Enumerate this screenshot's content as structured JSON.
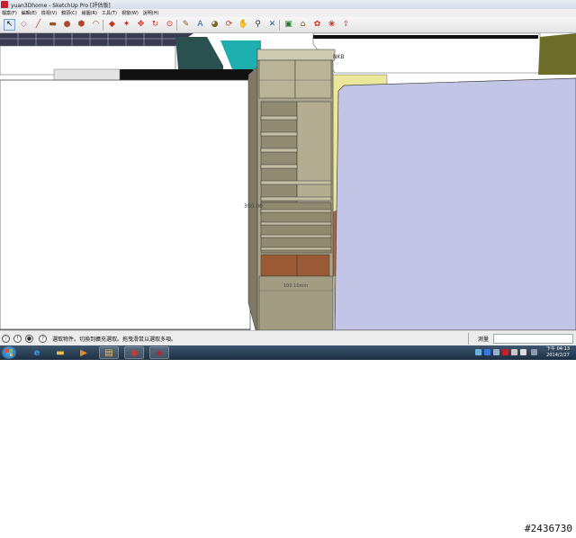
{
  "window": {
    "title": "yuan3Dhome - SketchUp Pro [評估版]"
  },
  "menu": {
    "items": [
      "檔案(F)",
      "編輯(E)",
      "檢視(V)",
      "鏡頭(C)",
      "繪圖(R)",
      "工具(T)",
      "視窗(W)",
      "說明(H)"
    ]
  },
  "toolbar": {
    "tools": [
      {
        "name": "select-tool-icon",
        "glyph": "↖",
        "color": "#222222",
        "active": true
      },
      {
        "name": "eraser-tool-icon",
        "glyph": "◇",
        "color": "#d86a8a"
      },
      {
        "name": "pencil-tool-icon",
        "glyph": "╱",
        "color": "#c83020"
      },
      {
        "name": "rectangle-tool-icon",
        "glyph": "▬",
        "color": "#a05020"
      },
      {
        "name": "circle-tool-icon",
        "glyph": "●",
        "color": "#b04830"
      },
      {
        "name": "polygon-tool-icon",
        "glyph": "⬢",
        "color": "#b04830"
      },
      {
        "name": "arc-tool-icon",
        "glyph": "◠",
        "color": "#c83020"
      },
      {
        "name": "push-pull-tool-icon",
        "glyph": "◆",
        "color": "#c83020"
      },
      {
        "name": "follow-me-tool-icon",
        "glyph": "✦",
        "color": "#c83020"
      },
      {
        "name": "move-tool-icon",
        "glyph": "✥",
        "color": "#c83020"
      },
      {
        "name": "rotate-tool-icon",
        "glyph": "↻",
        "color": "#c83020"
      },
      {
        "name": "offset-tool-icon",
        "glyph": "⊙",
        "color": "#c83020"
      },
      {
        "name": "tape-measure-tool-icon",
        "glyph": "✎",
        "color": "#806020"
      },
      {
        "name": "text-tool-icon",
        "glyph": "A",
        "color": "#1a5aaa"
      },
      {
        "name": "paint-bucket-tool-icon",
        "glyph": "◕",
        "color": "#806020"
      },
      {
        "name": "orbit-tool-icon",
        "glyph": "⟳",
        "color": "#c83020"
      },
      {
        "name": "pan-tool-icon",
        "glyph": "✋",
        "color": "#806020"
      },
      {
        "name": "zoom-tool-icon",
        "glyph": "⚲",
        "color": "#333333"
      },
      {
        "name": "zoom-extents-tool-icon",
        "glyph": "✕",
        "color": "#1a5aaa"
      },
      {
        "name": "components-icon",
        "glyph": "▣",
        "color": "#2a7a2a"
      },
      {
        "name": "warehouse-icon",
        "glyph": "⌂",
        "color": "#806020"
      },
      {
        "name": "extension-icon",
        "glyph": "✿",
        "color": "#c83020"
      },
      {
        "name": "materials-icon",
        "glyph": "❀",
        "color": "#c83020"
      },
      {
        "name": "share-model-icon",
        "glyph": "⇪",
        "color": "#c83020"
      }
    ]
  },
  "viewport": {
    "labels": [
      {
        "id": "label-nkb",
        "text": "NKB"
      },
      {
        "id": "label-dim",
        "text": "390.00"
      },
      {
        "id": "label-floor",
        "text": "100.10mm"
      }
    ],
    "colors": {
      "wall": "#ffffff",
      "wall_blue": "#c2c5e6",
      "wall_yellow": "#eae79a",
      "cabinet": "#a9a48a",
      "cabinet_dark": "#7e7a66",
      "drawer": "#9b5a36",
      "teal": "#1faeae",
      "dark_green": "#2a5050",
      "olive": "#6d6d2a",
      "black_bar": "#111111",
      "tile_grid": "#3a3a50"
    }
  },
  "status": {
    "message": "選取物件。切換到擴充選取。拖曳滑鼠以選取多項。",
    "measure_label": "測量",
    "measure_value": ""
  },
  "taskbar": {
    "apps": [
      {
        "name": "ie-taskbar-icon",
        "glyph": "e",
        "color": "#3a9ae0",
        "running": false
      },
      {
        "name": "explorer-taskbar-icon",
        "glyph": "▬",
        "color": "#e8c050",
        "running": false
      },
      {
        "name": "media-player-taskbar-icon",
        "glyph": "▶",
        "color": "#e88a2a",
        "running": false
      },
      {
        "name": "folder-taskbar-icon",
        "glyph": "▤",
        "color": "#e8c050",
        "running": true
      },
      {
        "name": "chrome-taskbar-icon",
        "glyph": "◉",
        "color": "#d8382a",
        "running": true
      },
      {
        "name": "sketchup-taskbar-icon",
        "glyph": "◈",
        "color": "#c8202a",
        "running": true
      }
    ],
    "clock_time": "下午 04:13",
    "clock_date": "2014/2/27"
  },
  "watermark": {
    "text": "#2436730"
  }
}
